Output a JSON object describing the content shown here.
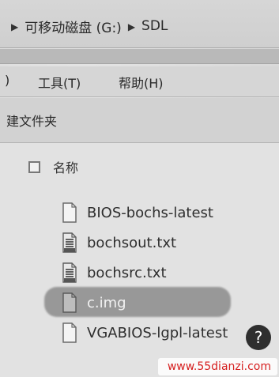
{
  "breadcrumb": {
    "items": [
      "可移动磁盘 (G:)",
      "SDL"
    ]
  },
  "menubar": {
    "items": [
      {
        "label": ")"
      },
      {
        "label": "工具(T)"
      },
      {
        "label": "帮助(H)"
      }
    ]
  },
  "toolbar": {
    "new_folder_label": "建文件夹"
  },
  "file_list": {
    "column_name": "名称",
    "files": [
      {
        "name": "BIOS-bochs-latest",
        "icon": "blank-file-icon"
      },
      {
        "name": "bochsout.txt",
        "icon": "text-file-icon"
      },
      {
        "name": "bochsrc.txt",
        "icon": "text-file-icon"
      },
      {
        "name": "c.img",
        "icon": "blank-file-icon",
        "selected": true
      },
      {
        "name": "VGABIOS-lgpl-latest",
        "icon": "blank-file-icon"
      }
    ]
  },
  "watermark": {
    "text": "www.55dianzi.com"
  },
  "badge": {
    "icon": "circle-badge-icon"
  }
}
